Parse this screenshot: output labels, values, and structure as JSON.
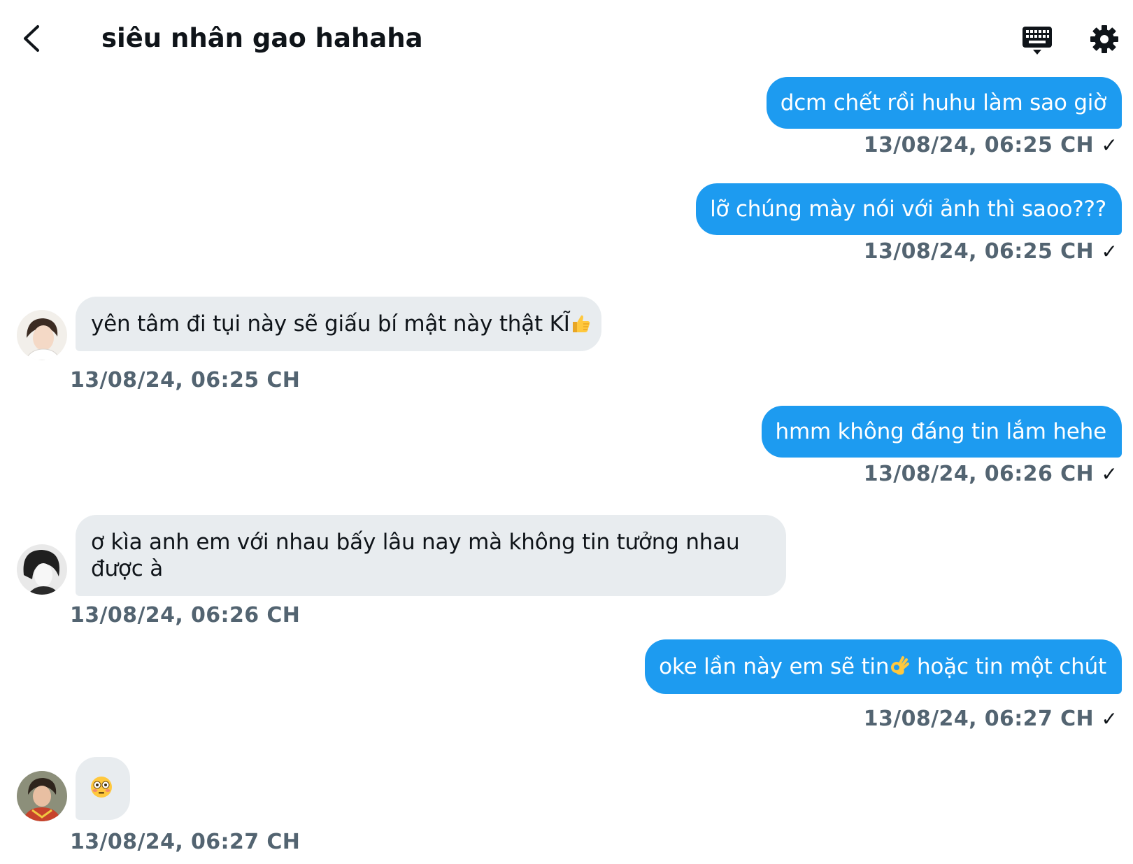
{
  "header": {
    "title": "siêu nhân gao hahaha",
    "back_icon": "chevron-left-icon",
    "keyboard_icon": "keyboard-icon",
    "settings_icon": "gear-icon"
  },
  "colors": {
    "outgoing_bubble": "#1d9bf0",
    "incoming_bubble": "#e8ecef",
    "timestamp": "#536471"
  },
  "messages": [
    {
      "direction": "out",
      "text": "dcm chết rồi huhu làm sao giờ",
      "timestamp": "13/08/24, 06:25 CH",
      "status": "✓"
    },
    {
      "direction": "out",
      "text": "lỡ chúng mày nói với ảnh thì saoo???",
      "timestamp": "13/08/24, 06:25 CH",
      "status": "✓"
    },
    {
      "direction": "in",
      "text": "yên tâm đi tụi này sẽ giấu bí mật này thật KĨ",
      "emoji": "thumbs-up",
      "timestamp": "13/08/24, 06:25 CH"
    },
    {
      "direction": "out",
      "text": "hmm không đáng tin lắm hehe",
      "timestamp": "13/08/24, 06:26 CH",
      "status": "✓"
    },
    {
      "direction": "in",
      "text": "ơ kìa anh em với nhau bấy lâu nay mà không tin tưởng nhau được à",
      "timestamp": "13/08/24, 06:26 CH"
    },
    {
      "direction": "out",
      "text_before": "oke lần này em sẽ tin",
      "emoji": "ok-hand",
      "text_after": " hoặc tin một chút",
      "timestamp": "13/08/24, 06:27 CH",
      "status": "✓"
    },
    {
      "direction": "in",
      "emoji": "flushed-face",
      "timestamp": "13/08/24, 06:27 CH"
    }
  ]
}
